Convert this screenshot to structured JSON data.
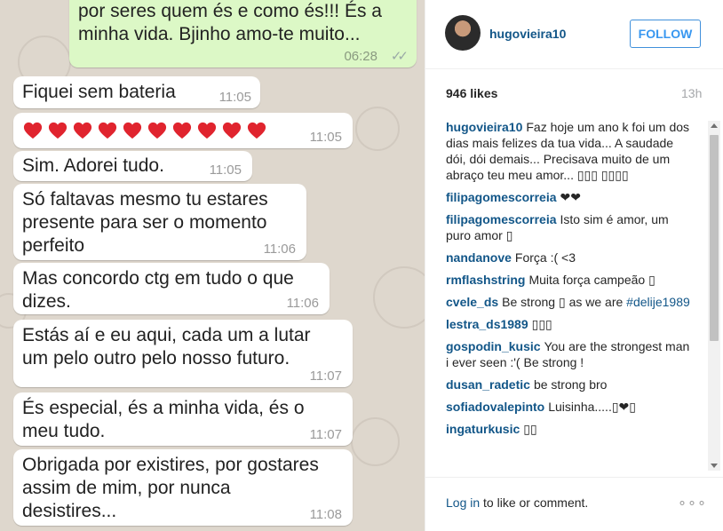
{
  "chat": {
    "top_message": {
      "text": "por seres quem és e como és!!! És a\nminha vida. Bjinho amo-te muito...",
      "time": "06:28"
    },
    "messages": [
      {
        "text": "Fiquei sem bateria",
        "time": "11:05"
      },
      {
        "text": "",
        "time": "11:05",
        "hearts": 10
      },
      {
        "text": "Sim.  Adorei tudo.",
        "time": "11:05"
      },
      {
        "text": "Só faltavas mesmo tu estares\npresente para ser o momento\nperfeito",
        "time": "11:06"
      },
      {
        "text": "Mas concordo ctg em tudo o que\ndizes.",
        "time": "11:06"
      },
      {
        "text": "Estás aí e eu aqui,  cada um a lutar\num pelo outro pelo nosso futuro.",
        "time": "11:07"
      },
      {
        "text": "És especial,  és a minha vida,  és o\nmeu tudo.",
        "time": "11:07"
      },
      {
        "text": "Obrigada por existires,  por gostares\nassim de mim,  por nunca\ndesistires...",
        "time": "11:08"
      }
    ]
  },
  "post": {
    "username": "hugovieira10",
    "follow_label": "FOLLOW",
    "likes": "946 likes",
    "time_ago": "13h",
    "comments": [
      {
        "user": "hugovieira10",
        "text": "Faz hoje um ano k foi um dos dias mais felizes da tua vida... A saudade dói, dói demais... Precisava muito de um abraço teu meu amor... ▯▯▯ ▯▯▯▯"
      },
      {
        "user": "filipagomescorreia",
        "text": "❤❤"
      },
      {
        "user": "filipagomescorreia",
        "text": "Isto sim é amor, um puro amor ▯"
      },
      {
        "user": "nandanove",
        "text": "Força :( <3"
      },
      {
        "user": "rmflashstring",
        "text": "Muita força campeão ▯"
      },
      {
        "user": "cvele_ds",
        "text": "Be strong ▯ as we are",
        "hashtag": "#delije1989"
      },
      {
        "user": "lestra_ds1989",
        "text": "▯▯▯"
      },
      {
        "user": "gospodin_kusic",
        "text": "You are the strongest man i ever seen :'( Be strong !"
      },
      {
        "user": "dusan_radetic",
        "text": "be strong bro"
      },
      {
        "user": "sofiadovalepinto",
        "text": "Luisinha.....▯❤▯"
      },
      {
        "user": "ingaturkusic",
        "text": "▯▯"
      }
    ],
    "footer": {
      "login_link": "Log in",
      "login_rest": " to like or comment.",
      "more": "∘∘∘"
    }
  },
  "colors": {
    "link": "#125688",
    "follow": "#3897f0",
    "chat_bg": "#ded7cd",
    "bubble_out": "#dcf8c6",
    "heart": "#e0242e"
  },
  "icons": [
    "double-check-icon",
    "heart-emoji-icon",
    "more-options-icon",
    "scroll-up-icon",
    "scroll-down-icon"
  ]
}
